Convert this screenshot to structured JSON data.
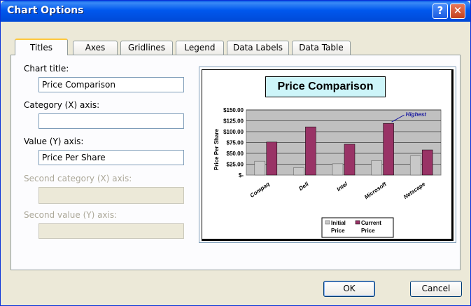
{
  "window": {
    "title": "Chart Options"
  },
  "tabs": [
    {
      "label": "Titles"
    },
    {
      "label": "Axes"
    },
    {
      "label": "Gridlines"
    },
    {
      "label": "Legend"
    },
    {
      "label": "Data Labels"
    },
    {
      "label": "Data Table"
    }
  ],
  "titles": {
    "chart_title_label": "Chart title:",
    "chart_title_value": "Price Comparison",
    "category_label": "Category (X) axis:",
    "category_value": "",
    "value_label": "Value (Y) axis:",
    "value_value": "Price Per Share",
    "second_category_label": "Second category (X) axis:",
    "second_value_label": "Second value (Y) axis:"
  },
  "buttons": {
    "ok": "OK",
    "cancel": "Cancel"
  },
  "chart_data": {
    "type": "bar",
    "title": "Price Comparison",
    "ylabel": "Price Per Share",
    "xlabel": "",
    "categories": [
      "Compaq",
      "Dell",
      "Intel",
      "Microsoft",
      "Netscape"
    ],
    "y_tick_labels": [
      "$150.00",
      "$125.00",
      "$100.00",
      "$75.00",
      "$50.00",
      "$25.00",
      "$-"
    ],
    "ylim": [
      0,
      150
    ],
    "grid": true,
    "series": [
      {
        "name": "Initial Price",
        "values": [
          32,
          17,
          26,
          33,
          44
        ],
        "color": "#c8c8c8"
      },
      {
        "name": "Current Price",
        "values": [
          76,
          111,
          71,
          119,
          58
        ],
        "color": "#993366"
      }
    ],
    "annotation": "Highest",
    "legend_position": "bottom-right"
  },
  "colors": {
    "titlebar": "#0058ee",
    "plot_area": "#c0c0c0",
    "current_price": "#993366"
  }
}
